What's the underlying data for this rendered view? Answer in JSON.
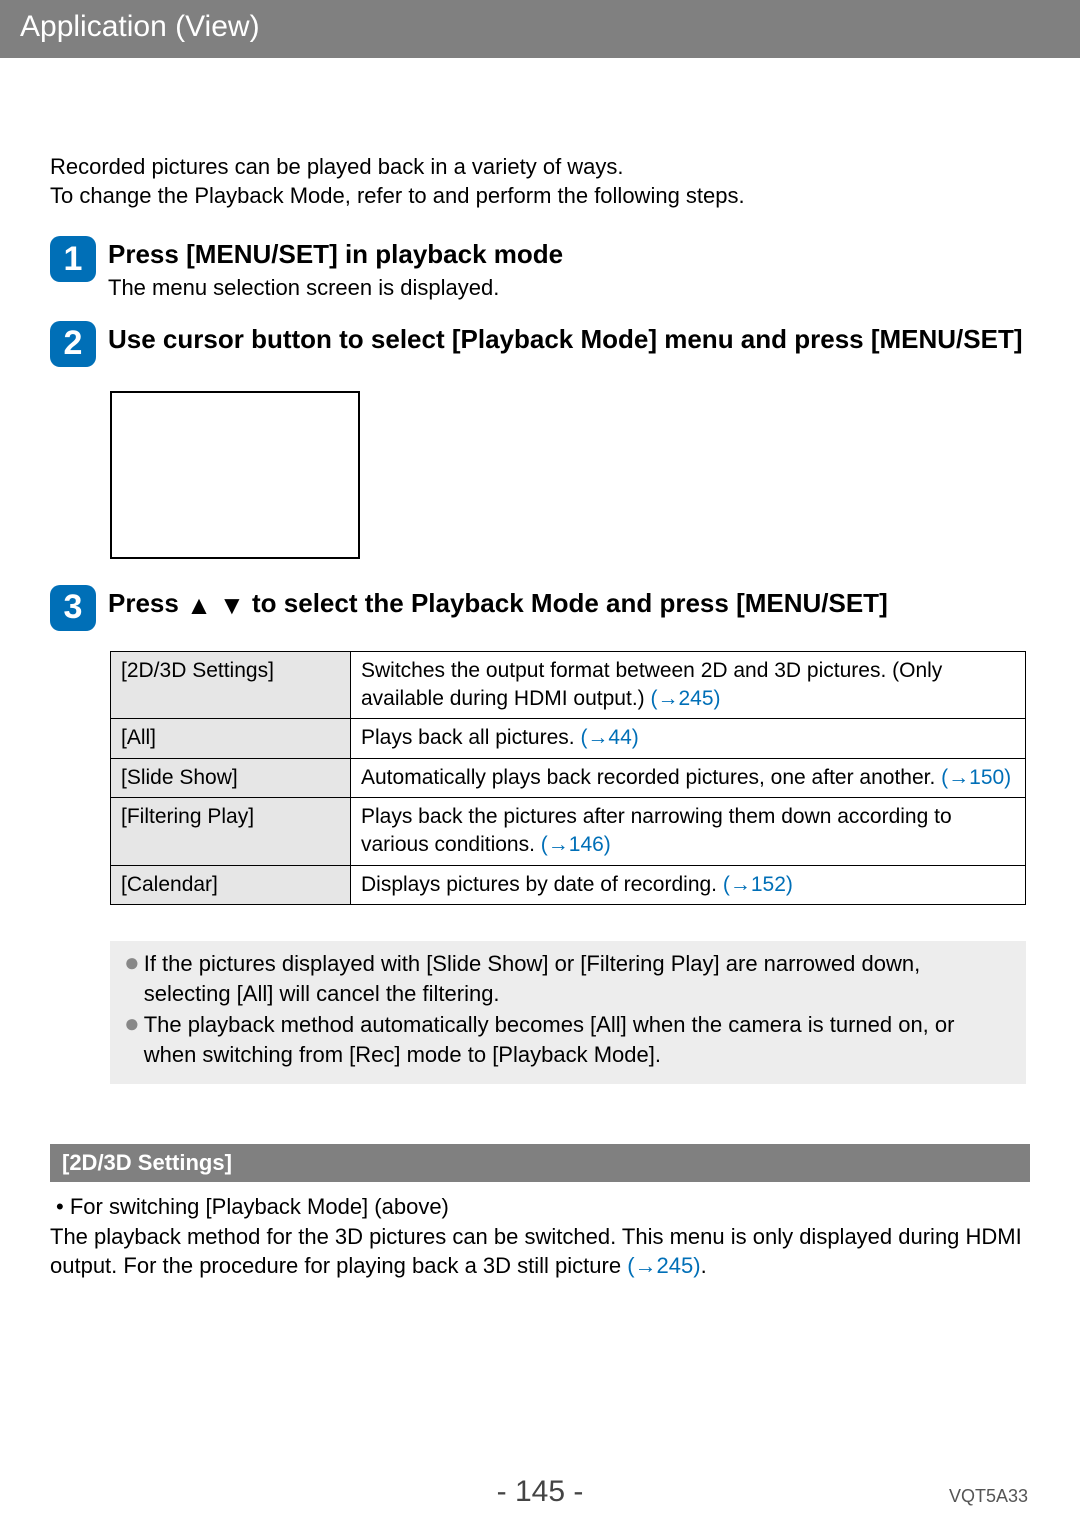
{
  "header": {
    "title": "Application (View)"
  },
  "intro": {
    "line1": "Recorded pictures can be played back in a variety of ways.",
    "line2": "To change the Playback Mode, refer to and perform the following steps."
  },
  "steps": [
    {
      "num": "1",
      "title": "Press [MENU/SET] in playback mode",
      "sub": "The menu selection screen is displayed."
    },
    {
      "num": "2",
      "title": "Use cursor button to select [Playback Mode] menu and press [MENU/SET]"
    },
    {
      "num": "3",
      "title_pre": "Press ",
      "title_post": " to select the Playback Mode and press [MENU/SET]"
    }
  ],
  "table": [
    {
      "key": "[2D/3D Settings]",
      "desc_pre": "Switches the output format between 2D and 3D pictures. (Only available during HDMI output.) ",
      "link": "(→245)",
      "desc_post": ""
    },
    {
      "key": "[All]",
      "desc_pre": "Plays back all pictures. ",
      "link": "(→44)",
      "desc_post": ""
    },
    {
      "key": "[Slide Show]",
      "desc_pre": "Automatically plays back recorded pictures, one after another. ",
      "link": "(→150)",
      "desc_post": ""
    },
    {
      "key": "[Filtering Play]",
      "desc_pre": "Plays back the pictures after narrowing them down according to various conditions. ",
      "link": "(→146)",
      "desc_post": ""
    },
    {
      "key": "[Calendar]",
      "desc_pre": "Displays pictures by date of recording. ",
      "link": "(→152)",
      "desc_post": ""
    }
  ],
  "notes": [
    "If the pictures displayed with [Slide Show] or [Filtering Play] are narrowed down, selecting [All] will cancel the filtering.",
    "The playback method automatically becomes [All] when the camera is turned on, or when switching from [Rec] mode to [Playback Mode]."
  ],
  "section": {
    "title": "[2D/3D Settings]",
    "bullet": "For switching [Playback Mode] (above)",
    "body_pre": "The playback method for the 3D pictures can be switched. This menu is only displayed during HDMI output. For the procedure for playing back a 3D still picture ",
    "body_link": "(→245)",
    "body_post": "."
  },
  "footer": {
    "page": "- 145 -",
    "doc_id": "VQT5A33"
  },
  "icons": {
    "dot": "●",
    "sbullet": "•",
    "tri_up": "▲",
    "tri_down": "▼"
  }
}
